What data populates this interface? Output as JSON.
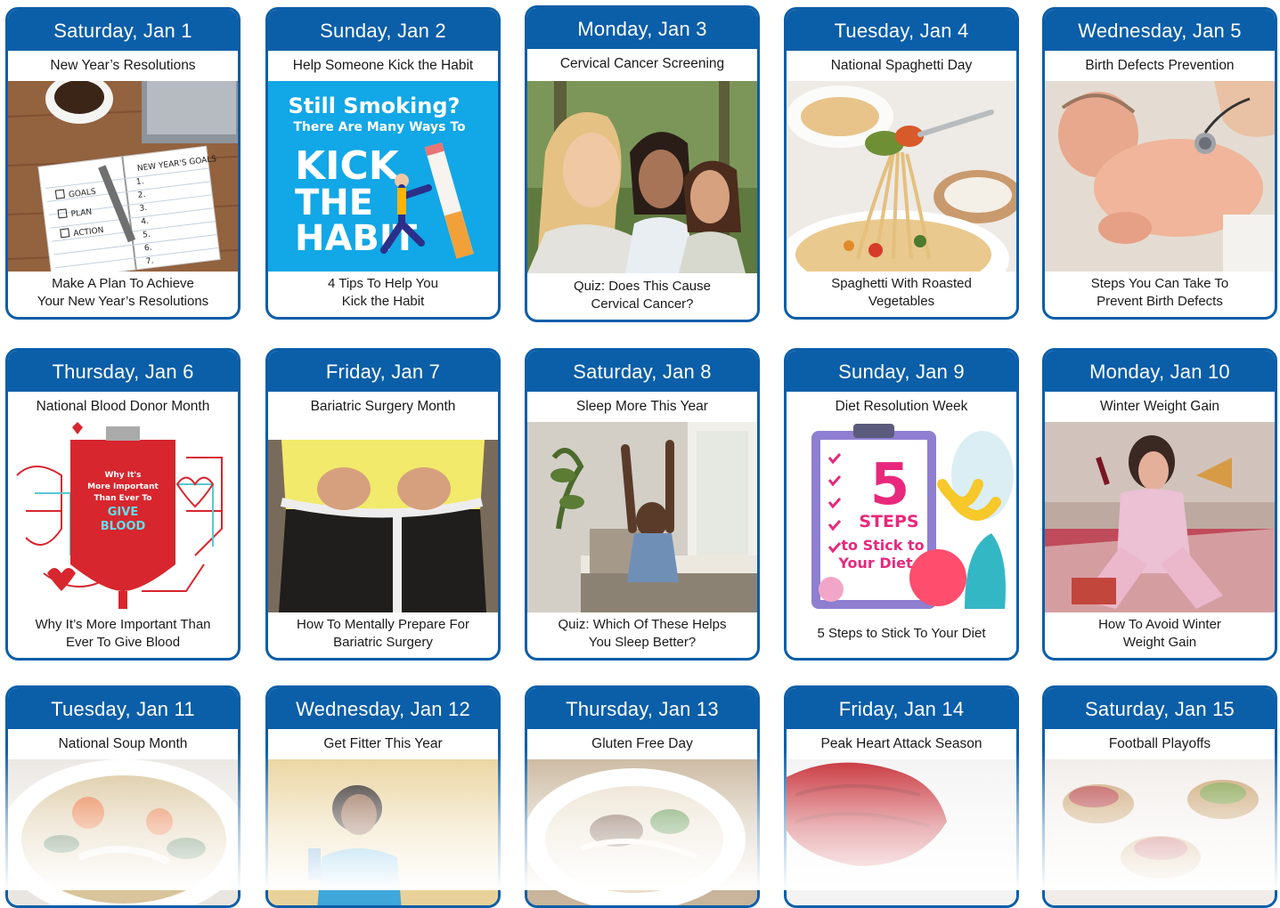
{
  "cards": [
    {
      "date": "Saturday, Jan 1",
      "topic": "New Year’s Resolutions",
      "caption_line1": "Make A Plan To Achieve",
      "caption_line2": "Your New Year’s Resolutions",
      "image_text": {
        "heading": "NEW YEAR'S GOALS",
        "item1": "GOALS",
        "item2": "PLAN",
        "item3": "ACTION",
        "n1": "1.",
        "n2": "2.",
        "n3": "3.",
        "n4": "4.",
        "n5": "5.",
        "n6": "6.",
        "n7": "7."
      }
    },
    {
      "date": "Sunday, Jan 2",
      "topic": "Help Someone Kick the Habit",
      "caption_line1": "4 Tips To Help You",
      "caption_line2": "Kick the Habit",
      "image_text": {
        "line1": "Still Smoking?",
        "line2": "There Are Many Ways To",
        "line3": "KICK",
        "line4": "THE",
        "line5": "HABIT"
      }
    },
    {
      "date": "Monday, Jan 3",
      "topic": "Cervical Cancer Screening",
      "caption_line1": "Quiz: Does This Cause",
      "caption_line2": "Cervical Cancer?"
    },
    {
      "date": "Tuesday, Jan 4",
      "topic": "National Spaghetti Day",
      "caption_line1": "Spaghetti With Roasted",
      "caption_line2": "Vegetables"
    },
    {
      "date": "Wednesday, Jan 5",
      "topic": "Birth Defects Prevention",
      "caption_line1": "Steps You Can Take To",
      "caption_line2": "Prevent Birth Defects"
    },
    {
      "date": "Thursday, Jan 6",
      "topic": "National Blood Donor Month",
      "caption_line1": "Why It’s More Important Than",
      "caption_line2": "Ever To Give Blood",
      "image_text": {
        "line1": "Why It's",
        "line2": "More Important",
        "line3": "Than Ever To",
        "line4": "GIVE",
        "line5": "BLOOD"
      }
    },
    {
      "date": "Friday, Jan 7",
      "topic": "Bariatric Surgery Month",
      "caption_line1": "How To Mentally Prepare For",
      "caption_line2": "Bariatric Surgery"
    },
    {
      "date": "Saturday, Jan 8",
      "topic": "Sleep More This Year",
      "caption_line1": "Quiz: Which Of These Helps",
      "caption_line2": "You Sleep Better?"
    },
    {
      "date": "Sunday, Jan 9",
      "topic": "Diet Resolution Week",
      "caption_line1": "5 Steps to Stick To Your Diet",
      "caption_line2": "",
      "image_text": {
        "number": "5",
        "line1": "STEPS",
        "line2": "to Stick to",
        "line3": "Your Diet"
      }
    },
    {
      "date": "Monday, Jan 10",
      "topic": "Winter Weight Gain",
      "caption_line1": "How To Avoid Winter",
      "caption_line2": "Weight Gain"
    },
    {
      "date": "Tuesday, Jan 11",
      "topic": "National Soup Month",
      "caption_line1": "",
      "caption_line2": ""
    },
    {
      "date": "Wednesday, Jan 12",
      "topic": "Get Fitter This Year",
      "caption_line1": "",
      "caption_line2": ""
    },
    {
      "date": "Thursday, Jan 13",
      "topic": "Gluten Free Day",
      "caption_line1": "",
      "caption_line2": ""
    },
    {
      "date": "Friday, Jan 14",
      "topic": "Peak Heart Attack Season",
      "caption_line1": "",
      "caption_line2": ""
    },
    {
      "date": "Saturday, Jan 15",
      "topic": "Football Playoffs",
      "caption_line1": "",
      "caption_line2": ""
    }
  ],
  "colors": {
    "header_blue": "#0b5ea8",
    "border_blue": "#0b5ea8",
    "text_dark": "#1a1a1a",
    "smoking_bg": "#12a7e6",
    "blood_red": "#d7262e",
    "diet_pink": "#e8287c"
  }
}
